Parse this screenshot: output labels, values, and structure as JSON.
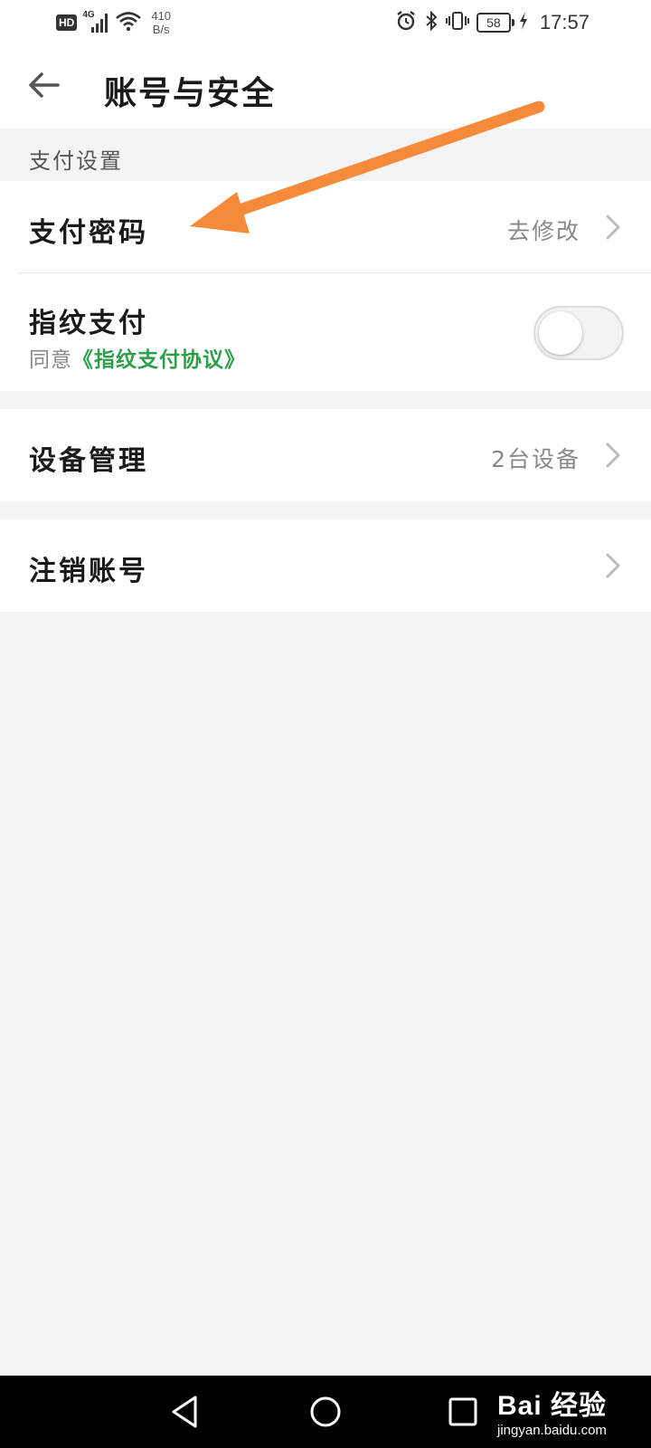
{
  "status_bar": {
    "hd": "HD",
    "network": "4G",
    "speed_value": "410",
    "speed_unit": "B/s",
    "battery": "58",
    "time": "17:57"
  },
  "header": {
    "title": "账号与安全"
  },
  "payment_section": {
    "label": "支付设置",
    "pay_password": {
      "title": "支付密码",
      "value": "去修改"
    },
    "fingerprint": {
      "title": "指纹支付",
      "agree_prefix": "同意",
      "agreement_link": "《指纹支付协议》",
      "enabled": false
    }
  },
  "device_row": {
    "title": "设备管理",
    "value": "2台设备"
  },
  "cancel_row": {
    "title": "注销账号"
  },
  "watermark": {
    "brand": "Bai 经验",
    "url": "jingyan.baidu.com"
  },
  "colors": {
    "link_green": "#2e9e4a",
    "annotation_orange": "#f58a3a",
    "background": "#f4f4f4"
  }
}
